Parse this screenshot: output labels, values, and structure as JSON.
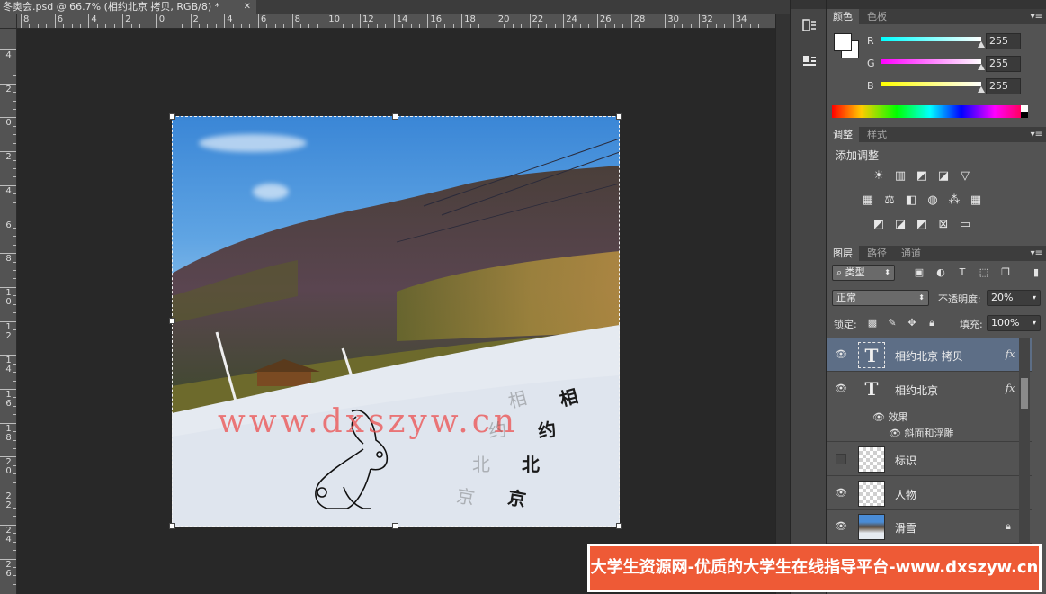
{
  "document": {
    "tab_title": "冬奥会.psd @ 66.7% (相约北京 拷贝, RGB/8) *",
    "close_glyph": "✕"
  },
  "rulers": {
    "top_labels": [
      "8",
      "6",
      "4",
      "2",
      "0",
      "2",
      "4",
      "6",
      "8",
      "10",
      "12",
      "14",
      "16",
      "18",
      "20",
      "22",
      "24",
      "26",
      "28",
      "30",
      "32",
      "34"
    ],
    "left_labels": [
      "4",
      "2",
      "0",
      "2",
      "4",
      "6",
      "8",
      "1 0",
      "1 2",
      "1 4",
      "1 6",
      "1 8",
      "2 0",
      "2 2",
      "2 4",
      "2 6"
    ]
  },
  "canvas": {
    "watermark_url": "www.dxszyw.cn",
    "vertical_text_main": [
      "相",
      "约",
      "北",
      "京"
    ],
    "vertical_text_ghost": [
      "相",
      "约",
      "北",
      "京"
    ]
  },
  "dock": {
    "history_icon": "history-icon",
    "properties_icon": "properties-icon"
  },
  "color_panel": {
    "tabs": [
      "颜色",
      "色板"
    ],
    "channels": [
      {
        "label": "R",
        "value": "255",
        "color": "#00ffff"
      },
      {
        "label": "G",
        "value": "255",
        "color": "#ff00ff"
      },
      {
        "label": "B",
        "value": "255",
        "color": "#ffff00"
      }
    ],
    "foreground": "#ffffff",
    "background": "#ffffff"
  },
  "adjustments_panel": {
    "tabs": [
      "调整",
      "样式"
    ],
    "title": "添加调整",
    "icons_row1": [
      "brightness-icon",
      "levels-icon",
      "curves-icon",
      "exposure-icon",
      "vibrance-icon"
    ],
    "icons_row2": [
      "hue-saturation-icon",
      "color-balance-icon",
      "black-white-icon",
      "photo-filter-icon",
      "channel-mixer-icon",
      "color-lookup-icon"
    ],
    "icons_row3": [
      "invert-icon",
      "posterize-icon",
      "threshold-icon",
      "gradient-map-icon",
      "selective-color-icon"
    ]
  },
  "layers_panel": {
    "tabs": [
      "图层",
      "路径",
      "通道"
    ],
    "filter_kind": "类型",
    "blend_mode": "正常",
    "opacity_label": "不透明度:",
    "opacity_value": "20%",
    "lock_label": "锁定:",
    "fill_label": "填充:",
    "fill_value": "100%",
    "layers": [
      {
        "name": "相约北京 拷贝",
        "type": "text",
        "visible": true,
        "selected": true,
        "fx": "fx"
      },
      {
        "name": "相约北京",
        "type": "text",
        "visible": true,
        "selected": false,
        "fx": "fx"
      },
      {
        "name": "标识",
        "type": "raster",
        "visible": false,
        "selected": false
      },
      {
        "name": "人物",
        "type": "raster",
        "visible": true,
        "selected": false
      },
      {
        "name": "滑雪",
        "type": "photo",
        "visible": true,
        "selected": false,
        "locked": true
      }
    ],
    "effects": {
      "label": "效果",
      "item": "斜面和浮雕"
    }
  },
  "banner": {
    "text": "大学生资源网-优质的大学生在线指导平台-www.dxszyw.cn",
    "color": "#ee5a36"
  }
}
